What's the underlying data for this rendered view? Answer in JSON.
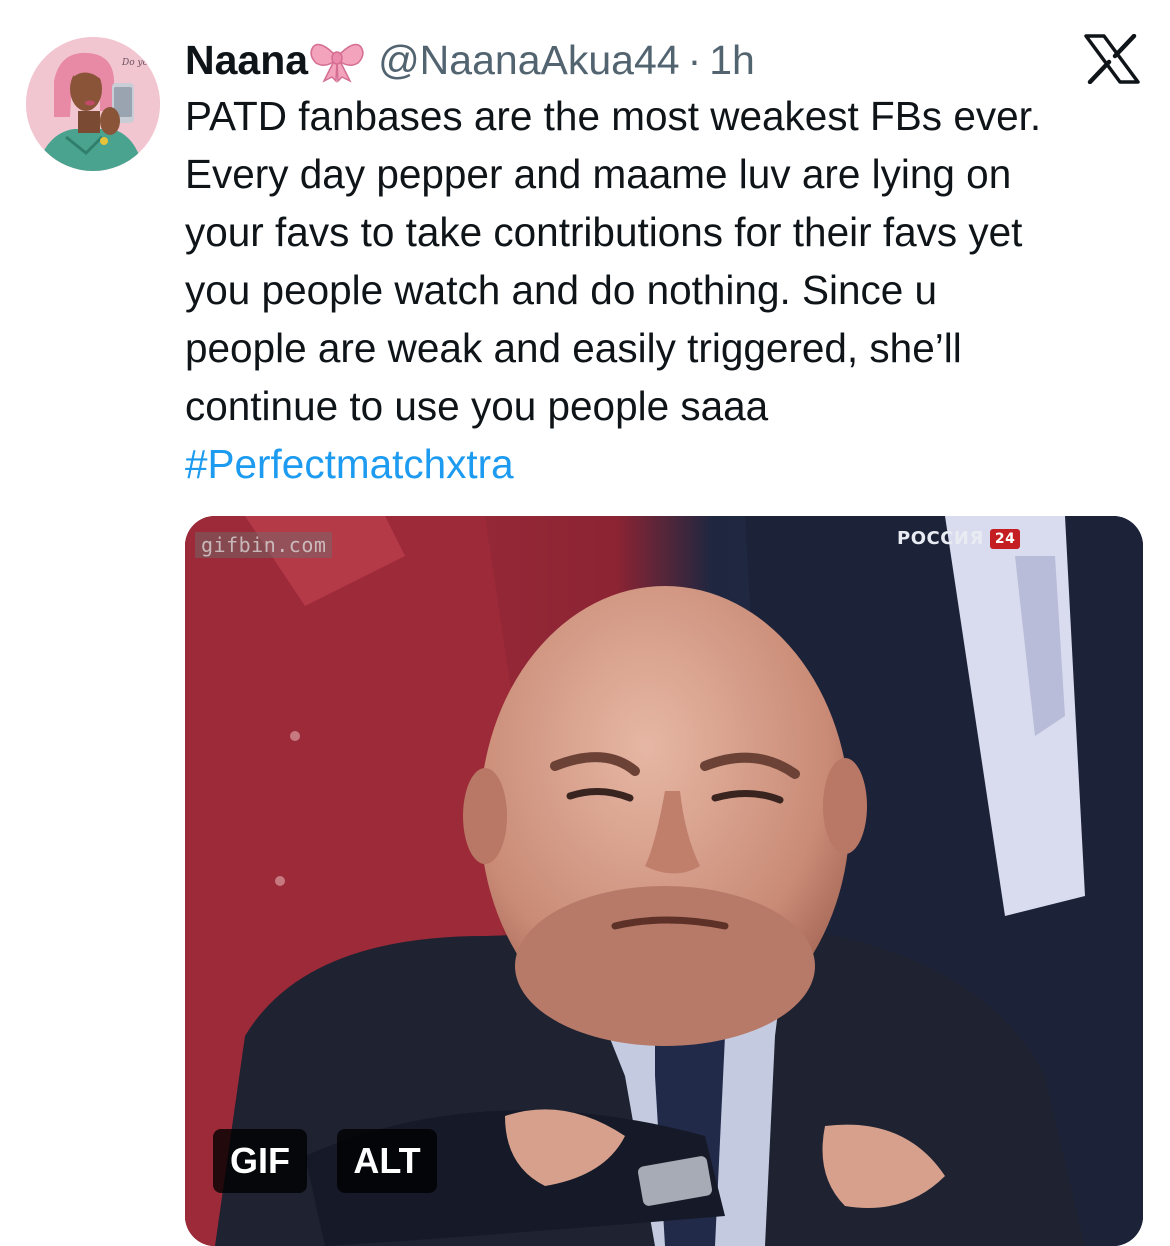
{
  "author": {
    "display_name": "Naana",
    "badge_emoji_icon": "pink-ribbon-bow",
    "handle": "@NaanaAkua44",
    "separator": "·",
    "time": "1h",
    "avatar_text": "Do you For you"
  },
  "platform_icon": "x-logo-icon",
  "tweet": {
    "lines": [
      "PATD fanbases are the most weakest FBs ever.",
      "Every day pepper and maame luv are lying on",
      "your favs to take contributions for their favs yet",
      "you people watch and do nothing. Since u",
      "people are weak and easily triggered, she’ll",
      "continue to use you people saaa"
    ],
    "hashtag": "#Perfectmatchxtra"
  },
  "media": {
    "watermark": "gifbin.com",
    "channel_name": "РОССИЯ",
    "channel_number": "24",
    "gif_badge": "GIF",
    "alt_badge": "ALT"
  },
  "colors": {
    "text": "#0f1419",
    "secondary": "#536471",
    "link": "#1d9bf0"
  }
}
